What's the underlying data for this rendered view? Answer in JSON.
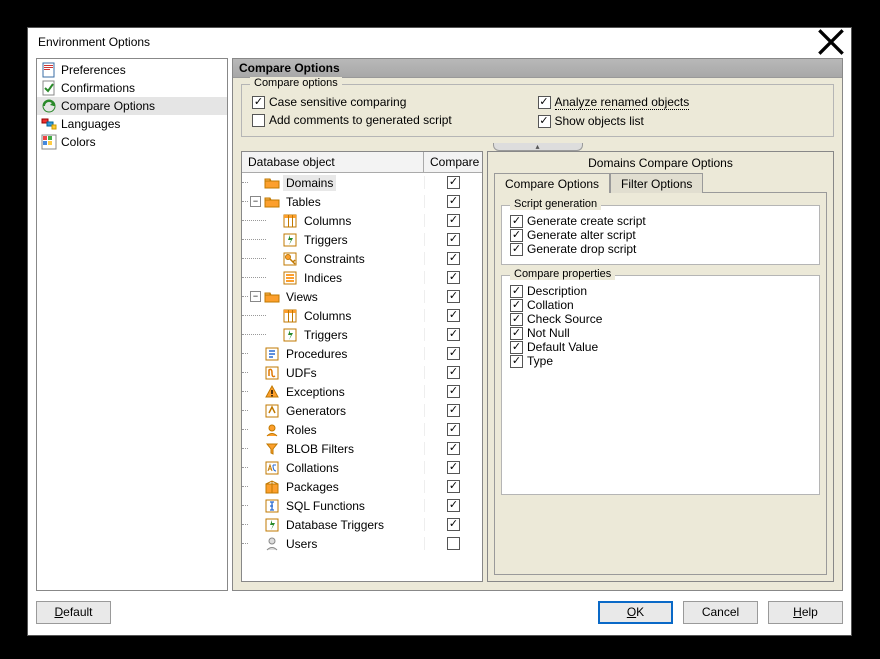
{
  "window": {
    "title": "Environment Options"
  },
  "nav": {
    "items": [
      {
        "label": "Preferences",
        "icon": "page"
      },
      {
        "label": "Confirmations",
        "icon": "doc-check"
      },
      {
        "label": "Compare Options",
        "icon": "refresh-green",
        "selected": true
      },
      {
        "label": "Languages",
        "icon": "flags"
      },
      {
        "label": "Colors",
        "icon": "grid-colors"
      }
    ]
  },
  "panel": {
    "header": "Compare Options"
  },
  "compare_options": {
    "group_title": "Compare options",
    "case_sensitive": {
      "label": "Case sensitive comparing",
      "checked": true
    },
    "add_comments": {
      "label": "Add comments to generated script",
      "checked": false
    },
    "analyze_renamed": {
      "label": "Analyze renamed objects",
      "checked": true
    },
    "show_objects": {
      "label": "Show objects list",
      "checked": true
    }
  },
  "tree": {
    "header": {
      "col1": "Database object",
      "col2": "Compare"
    },
    "rows": [
      {
        "label": "Domains",
        "icon": "folder",
        "depth": 0,
        "exp": null,
        "checked": true,
        "selected": true
      },
      {
        "label": "Tables",
        "icon": "folder",
        "depth": 0,
        "exp": "expanded",
        "checked": true
      },
      {
        "label": "Columns",
        "icon": "columns",
        "depth": 1,
        "exp": null,
        "checked": true
      },
      {
        "label": "Triggers",
        "icon": "trigger",
        "depth": 1,
        "exp": null,
        "checked": true
      },
      {
        "label": "Constraints",
        "icon": "key",
        "depth": 1,
        "exp": null,
        "checked": true
      },
      {
        "label": "Indices",
        "icon": "index",
        "depth": 1,
        "exp": null,
        "checked": true
      },
      {
        "label": "Views",
        "icon": "folder",
        "depth": 0,
        "exp": "expanded",
        "checked": true
      },
      {
        "label": "Columns",
        "icon": "columns",
        "depth": 1,
        "exp": null,
        "checked": true
      },
      {
        "label": "Triggers",
        "icon": "trigger",
        "depth": 1,
        "exp": null,
        "checked": true
      },
      {
        "label": "Procedures",
        "icon": "proc",
        "depth": 0,
        "exp": null,
        "checked": true
      },
      {
        "label": "UDFs",
        "icon": "udf",
        "depth": 0,
        "exp": null,
        "checked": true
      },
      {
        "label": "Exceptions",
        "icon": "warn",
        "depth": 0,
        "exp": null,
        "checked": true
      },
      {
        "label": "Generators",
        "icon": "gen",
        "depth": 0,
        "exp": null,
        "checked": true
      },
      {
        "label": "Roles",
        "icon": "role",
        "depth": 0,
        "exp": null,
        "checked": true
      },
      {
        "label": "BLOB Filters",
        "icon": "filter",
        "depth": 0,
        "exp": null,
        "checked": true
      },
      {
        "label": "Collations",
        "icon": "coll",
        "depth": 0,
        "exp": null,
        "checked": true
      },
      {
        "label": "Packages",
        "icon": "pkg",
        "depth": 0,
        "exp": null,
        "checked": true
      },
      {
        "label": "SQL Functions",
        "icon": "func",
        "depth": 0,
        "exp": null,
        "checked": true
      },
      {
        "label": "Database Triggers",
        "icon": "trigger",
        "depth": 0,
        "exp": null,
        "checked": true
      },
      {
        "label": "Users",
        "icon": "user",
        "depth": 0,
        "exp": null,
        "checked": false
      }
    ]
  },
  "right": {
    "title": "Domains Compare Options",
    "tabs": {
      "active": "Compare Options",
      "other": "Filter Options"
    },
    "script_gen": {
      "title": "Script generation",
      "items": [
        {
          "label": "Generate create script",
          "checked": true
        },
        {
          "label": "Generate alter script",
          "checked": true
        },
        {
          "label": "Generate drop script",
          "checked": true
        }
      ]
    },
    "compare_props": {
      "title": "Compare properties",
      "items": [
        {
          "label": "Description",
          "checked": true
        },
        {
          "label": "Collation",
          "checked": true
        },
        {
          "label": "Check Source",
          "checked": true
        },
        {
          "label": "Not Null",
          "checked": true
        },
        {
          "label": "Default Value",
          "checked": true
        },
        {
          "label": "Type",
          "checked": true
        }
      ]
    }
  },
  "buttons": {
    "default": "Default",
    "ok": "OK",
    "cancel": "Cancel",
    "help": "Help"
  }
}
